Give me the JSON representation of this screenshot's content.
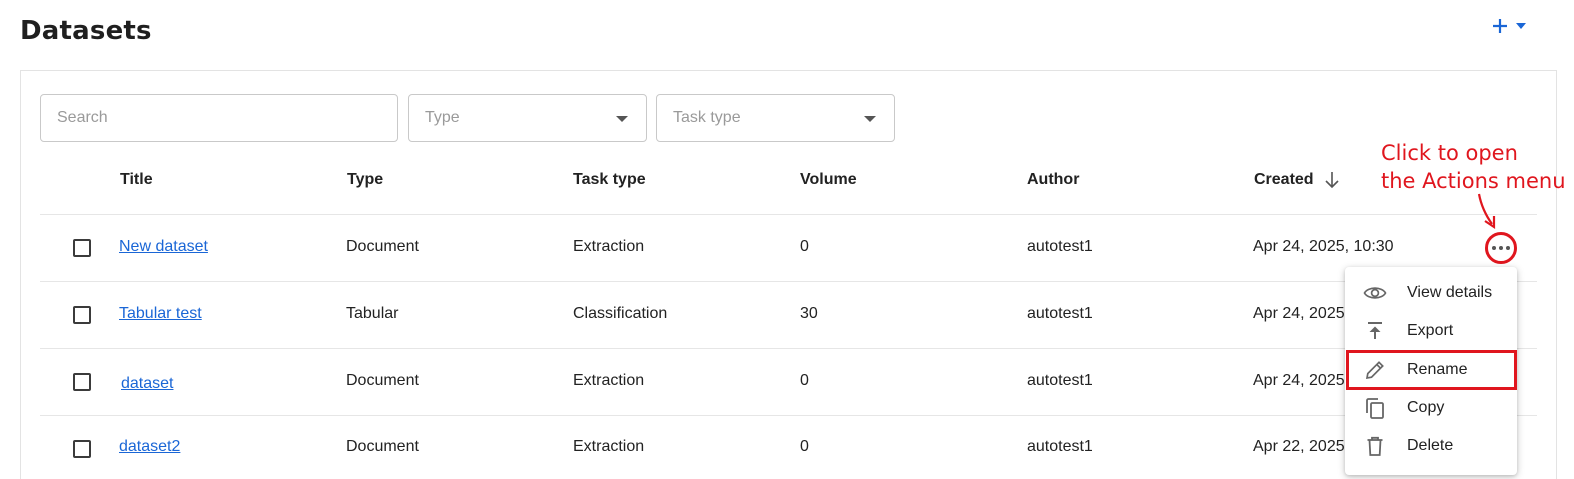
{
  "header": {
    "title": "Datasets",
    "add_icon": "plus-icon",
    "add_caret_icon": "caret-down-icon",
    "accent_color": "#1a66d6"
  },
  "filters": {
    "search_placeholder": "Search",
    "type_placeholder": "Type",
    "task_type_placeholder": "Task type"
  },
  "table": {
    "columns": [
      "Title",
      "Type",
      "Task type",
      "Volume",
      "Author",
      "Created"
    ],
    "sort_icon": "arrow-down-icon",
    "rows": [
      {
        "title": "New dataset",
        "type": "Document",
        "task_type": "Extraction",
        "volume": "0",
        "author": "autotest1",
        "created": "Apr 24, 2025, 10:30"
      },
      {
        "title": "Tabular test",
        "type": "Tabular",
        "task_type": "Classification",
        "volume": "30",
        "author": "autotest1",
        "created": "Apr 24, 2025"
      },
      {
        "title": "dataset",
        "type": "Document",
        "task_type": "Extraction",
        "volume": "0",
        "author": "autotest1",
        "created": "Apr 24, 2025"
      },
      {
        "title": "dataset2",
        "type": "Document",
        "task_type": "Extraction",
        "volume": "0",
        "author": "autotest1",
        "created": "Apr 22, 2025"
      }
    ]
  },
  "annotation": {
    "line1": "Click to open",
    "line2": "the Actions menu",
    "color": "#e0161e"
  },
  "actions_menu": {
    "items": [
      {
        "label": "View details",
        "icon": "eye-icon"
      },
      {
        "label": "Export",
        "icon": "export-icon"
      },
      {
        "label": "Rename",
        "icon": "pencil-icon"
      },
      {
        "label": "Copy",
        "icon": "copy-icon"
      },
      {
        "label": "Delete",
        "icon": "trash-icon"
      }
    ],
    "highlighted": "Rename"
  }
}
